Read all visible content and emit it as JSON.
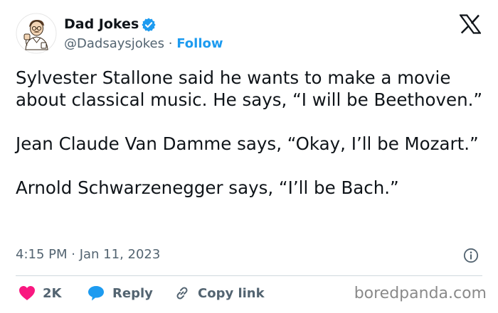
{
  "author": {
    "name": "Dad Jokes",
    "handle": "@Dadsaysjokes",
    "separator": "·",
    "follow_label": "Follow",
    "avatar_icon": "dad-cartoon-avatar",
    "verified_icon": "verified-badge-icon"
  },
  "platform_icon": "x-logo-icon",
  "tweet": {
    "paragraphs": [
      "Sylvester Stallone said he wants to make a movie about classical music. He says, “I will be Beethoven.”",
      "Jean Claude Van Damme says, “Okay, I’ll be Mozart.”",
      "Arnold Schwarzenegger says, “I’ll be Bach.”"
    ],
    "timestamp": "4:15 PM · Jan 11, 2023"
  },
  "actions": {
    "like_count": "2K",
    "reply_label": "Reply",
    "copy_link_label": "Copy link"
  },
  "watermark": "boredpanda.com",
  "colors": {
    "accent": "#1d9bf0",
    "like": "#f91880",
    "text": "#0f1419",
    "muted": "#536471"
  }
}
